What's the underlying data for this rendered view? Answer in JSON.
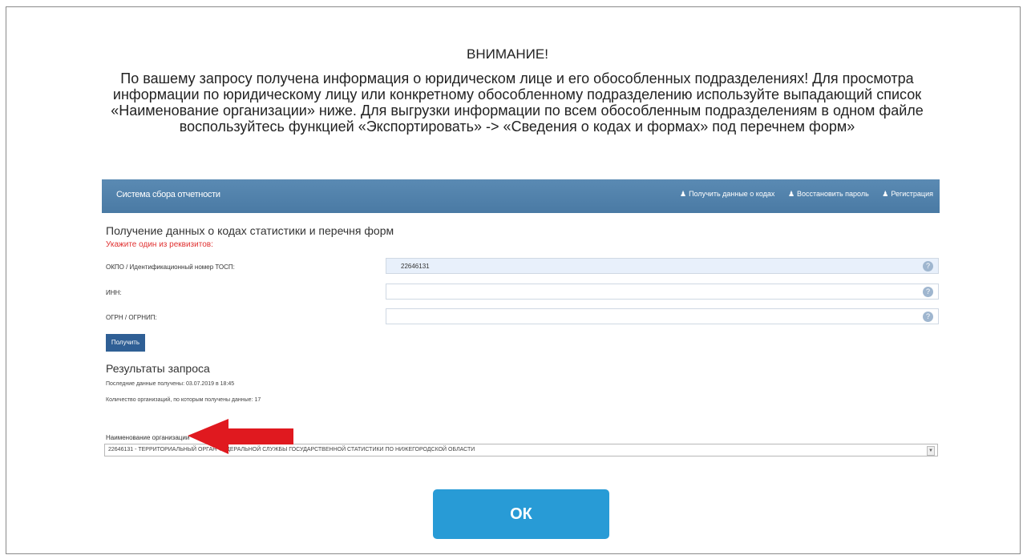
{
  "dialog": {
    "heading": "ВНИМАНИЕ!",
    "message": "По вашему запросу получена информация о юридическом лице и его обособленных подразделениях! Для просмотра информации по юридическому лицу или конкретному обособленному подразделению используйте выпадающий список «Наименование организации» ниже. Для выгрузки информации по всем обособленным подразделениям в одном файле воспользуйтесь функцией «Экспортировать» -> «Сведения о кодах и формах» под перечнем форм»",
    "ok_label": "ОК"
  },
  "embedded": {
    "brand": "Система сбора отчетности",
    "nav": [
      "Получить данные о кодах",
      "Восстановить пароль",
      "Регистрация"
    ],
    "section_title": "Получение данных о кодах статистики и перечня форм",
    "hint": "Укажите один из реквизитов:",
    "fields": [
      {
        "label": "ОКПО / Идентификационный номер ТОСП:",
        "value": "22646131"
      },
      {
        "label": "ИНН:",
        "value": ""
      },
      {
        "label": "ОГРН / ОГРНИП:",
        "value": ""
      }
    ],
    "get_button": "Получить",
    "results_title": "Результаты запроса",
    "last_update": "Последние данные получены: 03.07.2019 в 18:45",
    "org_count": "Количество организаций, по которым получены данные: 17",
    "org_label": "Наименование организации",
    "org_value": "22646131 - ТЕРРИТОРИАЛЬНЫЙ ОРГАН ФЕДЕРАЛЬНОЙ СЛУЖБЫ ГОСУДАРСТВЕННОЙ СТАТИСТИКИ ПО НИЖЕГОРОДСКОЙ ОБЛАСТИ"
  },
  "colors": {
    "ok_button": "#289bd6",
    "navbar": "#4f7fa9",
    "arrow": "#e0191f",
    "hint": "#e03030"
  }
}
